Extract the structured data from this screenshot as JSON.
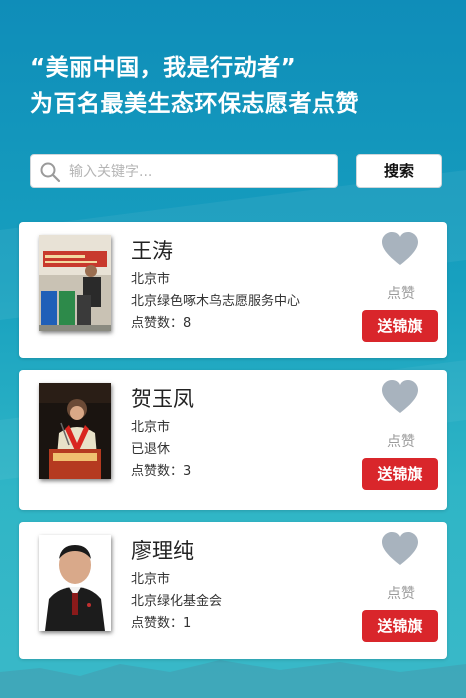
{
  "header": {
    "title_line1": "“美丽中国，我是行动者”",
    "title_line2": "为百名最美生态环保志愿者点赞"
  },
  "search": {
    "placeholder": "输入关键字...",
    "button_label": "搜索",
    "icon": "search-icon"
  },
  "volunteers": [
    {
      "name": "王涛",
      "city": "北京市",
      "org": "北京绿色啄木鸟志愿服务中心",
      "likes_text": "点赞数：8",
      "like_label": "点赞",
      "flag_label": "送锦旗"
    },
    {
      "name": "贺玉凤",
      "city": "北京市",
      "org": "已退休",
      "likes_text": "点赞数：3",
      "like_label": "点赞",
      "flag_label": "送锦旗"
    },
    {
      "name": "廖理纯",
      "city": "北京市",
      "org": "北京绿化基金会",
      "likes_text": "点赞数：1",
      "like_label": "点赞",
      "flag_label": "送锦旗"
    }
  ],
  "colors": {
    "accent_red": "#d9262b",
    "heart_gray": "#a8b3be",
    "background_teal": "#17a0bf"
  }
}
